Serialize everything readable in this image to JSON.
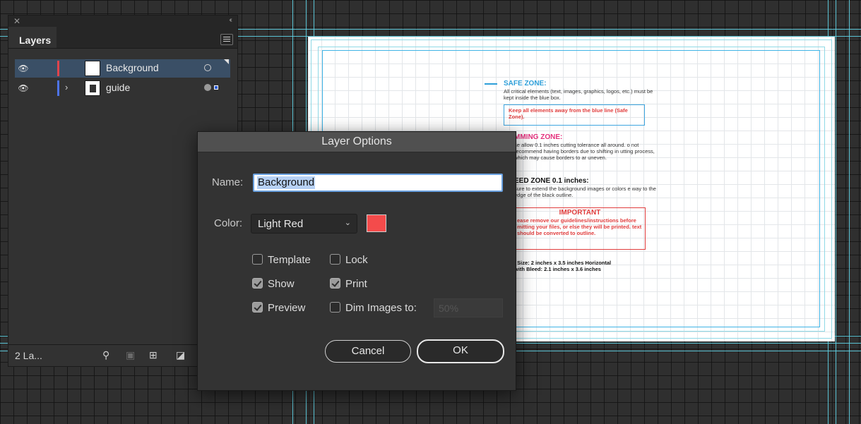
{
  "layers_panel": {
    "tab": "Layers",
    "layers": [
      {
        "name": "Background",
        "color": "#e0444c",
        "selected": true
      },
      {
        "name": "guide",
        "color": "#4d73e8",
        "selected": false
      }
    ],
    "count_label": "2 La..."
  },
  "artboard": {
    "safe_zone": {
      "heading": "SAFE ZONE:",
      "body": "All critical elements (text, images, graphics, logos, etc.) must be kept inside the blue box.",
      "box_text": "Keep all elements away from the blue line (Safe Zone)."
    },
    "trim_zone": {
      "heading": "MMING ZONE:",
      "body": "se allow 0.1 inches cutting tolerance all around. o not recommend having borders due to shifting in utting process, which may cause borders to ar uneven."
    },
    "bleed_zone": {
      "heading": "EED ZONE 0.1 inches:",
      "body": "sure to extend the background images or colors e way to the edge of the black outline."
    },
    "important": {
      "heading": "IMPORTANT",
      "body": "ease remove our guidelines/instructions before mitting your files, or else they will be printed. text should be converted to outline."
    },
    "size_line1": "l Size: 2 inches x 3.5 inches Horizontal",
    "size_line2": "with Bleed: 2.1 inches x 3.6 inches"
  },
  "dialog": {
    "title": "Layer Options",
    "name_label": "Name:",
    "name_value": "Background",
    "color_label": "Color:",
    "color_value": "Light Red",
    "swatch_color": "#f44b4b",
    "options": {
      "template": "Template",
      "lock": "Lock",
      "show": "Show",
      "print": "Print",
      "preview": "Preview",
      "dim_images": "Dim Images to:"
    },
    "dim_value": "50%",
    "cancel": "Cancel",
    "ok": "OK"
  }
}
